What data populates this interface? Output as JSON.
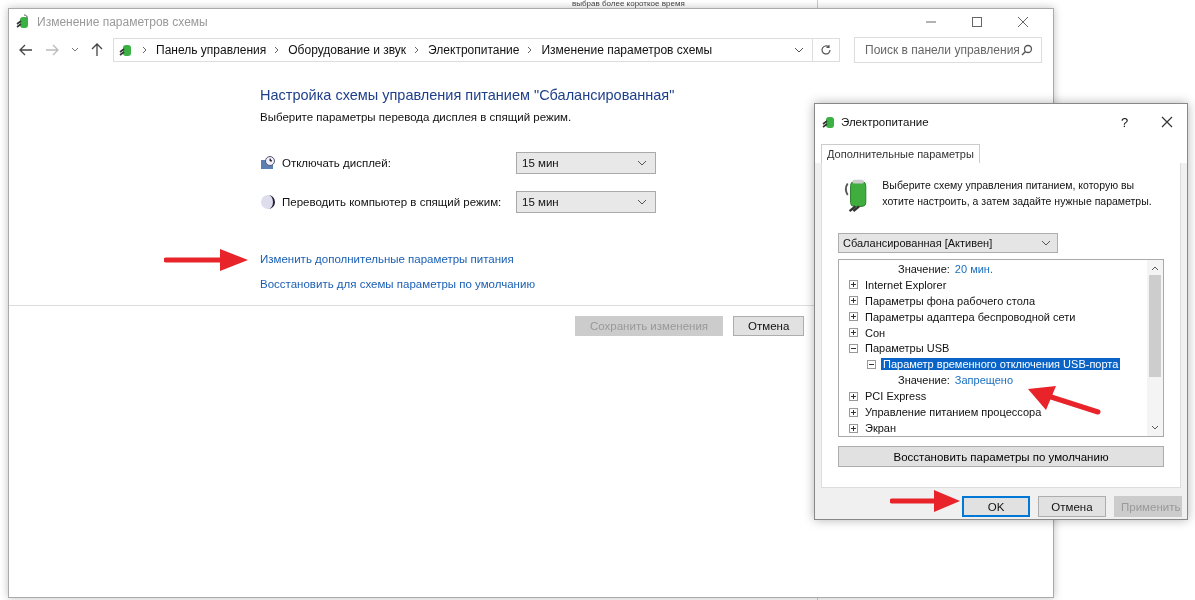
{
  "background_window": {
    "text": "выбрав более короткое время"
  },
  "window": {
    "title": "Изменение параметров схемы"
  },
  "address_bar": {
    "breadcrumbs": [
      "Панель управления",
      "Оборудование и звук",
      "Электропитание",
      "Изменение параметров схемы"
    ]
  },
  "search": {
    "placeholder": "Поиск в панели управления"
  },
  "heading": "Настройка схемы управления питанием \"Сбалансированная\"",
  "subtitle": "Выберите параметры перевода дисплея в спящий режим.",
  "settings": [
    {
      "kind": "display",
      "label": "Отключать дисплей:",
      "value": "15 мин"
    },
    {
      "kind": "sleep",
      "label": "Переводить компьютер в спящий режим:",
      "value": "15 мин"
    }
  ],
  "links": [
    "Изменить дополнительные параметры питания",
    "Восстановить для схемы параметры по умолчанию"
  ],
  "buttons": [
    {
      "label": "Сохранить изменения",
      "disabled": true
    },
    {
      "label": "Отмена",
      "disabled": false
    }
  ],
  "dialog": {
    "title": "Электропитание",
    "help": "?",
    "tabs": [
      {
        "label": "Дополнительные параметры",
        "selected": true
      }
    ],
    "description": "Выберите схему управления питанием, которую вы хотите настроить, а затем задайте нужные параметры.",
    "plan": "Сбалансированная [Активен]",
    "tree": [
      {
        "kind": "value",
        "label": "Значение:",
        "value": "20 мин."
      },
      {
        "kind": "node",
        "label": "Internet Explorer",
        "expanded": false,
        "selected": false
      },
      {
        "kind": "node",
        "label": "Параметры фона рабочего стола",
        "expanded": false,
        "selected": false
      },
      {
        "kind": "node",
        "label": "Параметры адаптера беспроводной сети",
        "expanded": false,
        "selected": false
      },
      {
        "kind": "node",
        "label": "Сон",
        "expanded": false,
        "selected": false
      },
      {
        "kind": "node",
        "label": "Параметры USB",
        "expanded": true,
        "selected": false,
        "children": [
          {
            "kind": "node",
            "label": "Параметр временного отключения USB-порта",
            "expanded": true,
            "selected": true,
            "children": [
              {
                "kind": "value",
                "label": "Значение:",
                "value": "Запрещено"
              }
            ]
          }
        ]
      },
      {
        "kind": "node",
        "label": "PCI Express",
        "expanded": false,
        "selected": false
      },
      {
        "kind": "node",
        "label": "Управление питанием процессора",
        "expanded": false,
        "selected": false
      },
      {
        "kind": "node",
        "label": "Экран",
        "expanded": false,
        "selected": false
      }
    ],
    "restore_button": "Восстановить параметры по умолчанию",
    "buttons": [
      {
        "label": "OK",
        "disabled": false,
        "default": true
      },
      {
        "label": "Отмена",
        "disabled": false,
        "default": false
      },
      {
        "label": "Применить",
        "disabled": true,
        "default": false
      }
    ]
  }
}
